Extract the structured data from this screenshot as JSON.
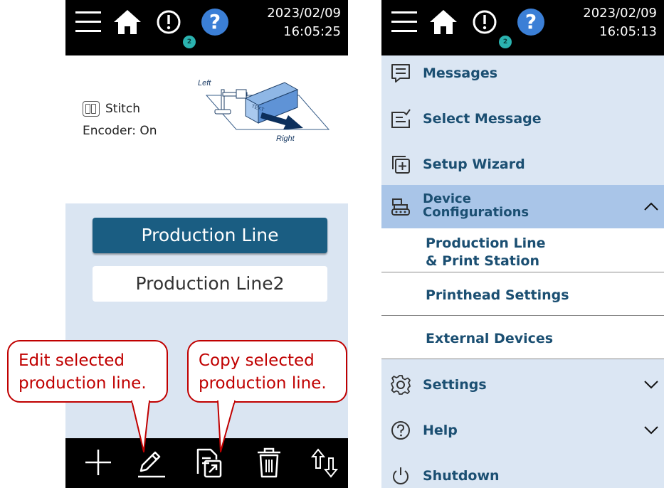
{
  "left": {
    "status": {
      "date": "2023/02/09",
      "time": "16:05:25",
      "alert_count": "2",
      "help_glyph": "?"
    },
    "info": {
      "mode_label": "Stitch",
      "encoder_label": "Encoder: On"
    },
    "diagram": {
      "left_label": "Left",
      "right_label": "Right",
      "box_text": "TEXT"
    },
    "production_lines": [
      {
        "label": "Production Line",
        "selected": true
      },
      {
        "label": "Production Line2",
        "selected": false
      }
    ],
    "callouts": {
      "edit": "Edit selected production line.",
      "copy": "Copy selected production line."
    },
    "toolbar_icons": [
      "plus-icon",
      "edit-icon",
      "copy-icon",
      "trash-icon",
      "sort-icon"
    ]
  },
  "right": {
    "status": {
      "date": "2023/02/09",
      "time": "16:05:13",
      "alert_count": "2",
      "help_glyph": "?"
    },
    "menu": {
      "messages": "Messages",
      "select_message": "Select Message",
      "setup_wizard": "Setup Wizard",
      "device_config_line1": "Device",
      "device_config_line2": "Configurations",
      "settings": "Settings",
      "help": "Help",
      "shutdown": "Shutdown"
    },
    "submenu": {
      "production_line_1": "Production Line",
      "production_line_2": "& Print Station",
      "printhead_settings": "Printhead Settings",
      "external_devices": "External Devices"
    }
  },
  "colors": {
    "accent_dark_blue": "#1a5d82",
    "menu_text": "#1b4f72",
    "list_background": "#dae5f2",
    "active_menu": "#a9c5e8",
    "callout_red": "#c00000",
    "help_blue": "#3b7fd6",
    "badge_teal": "#2bb3b0"
  }
}
